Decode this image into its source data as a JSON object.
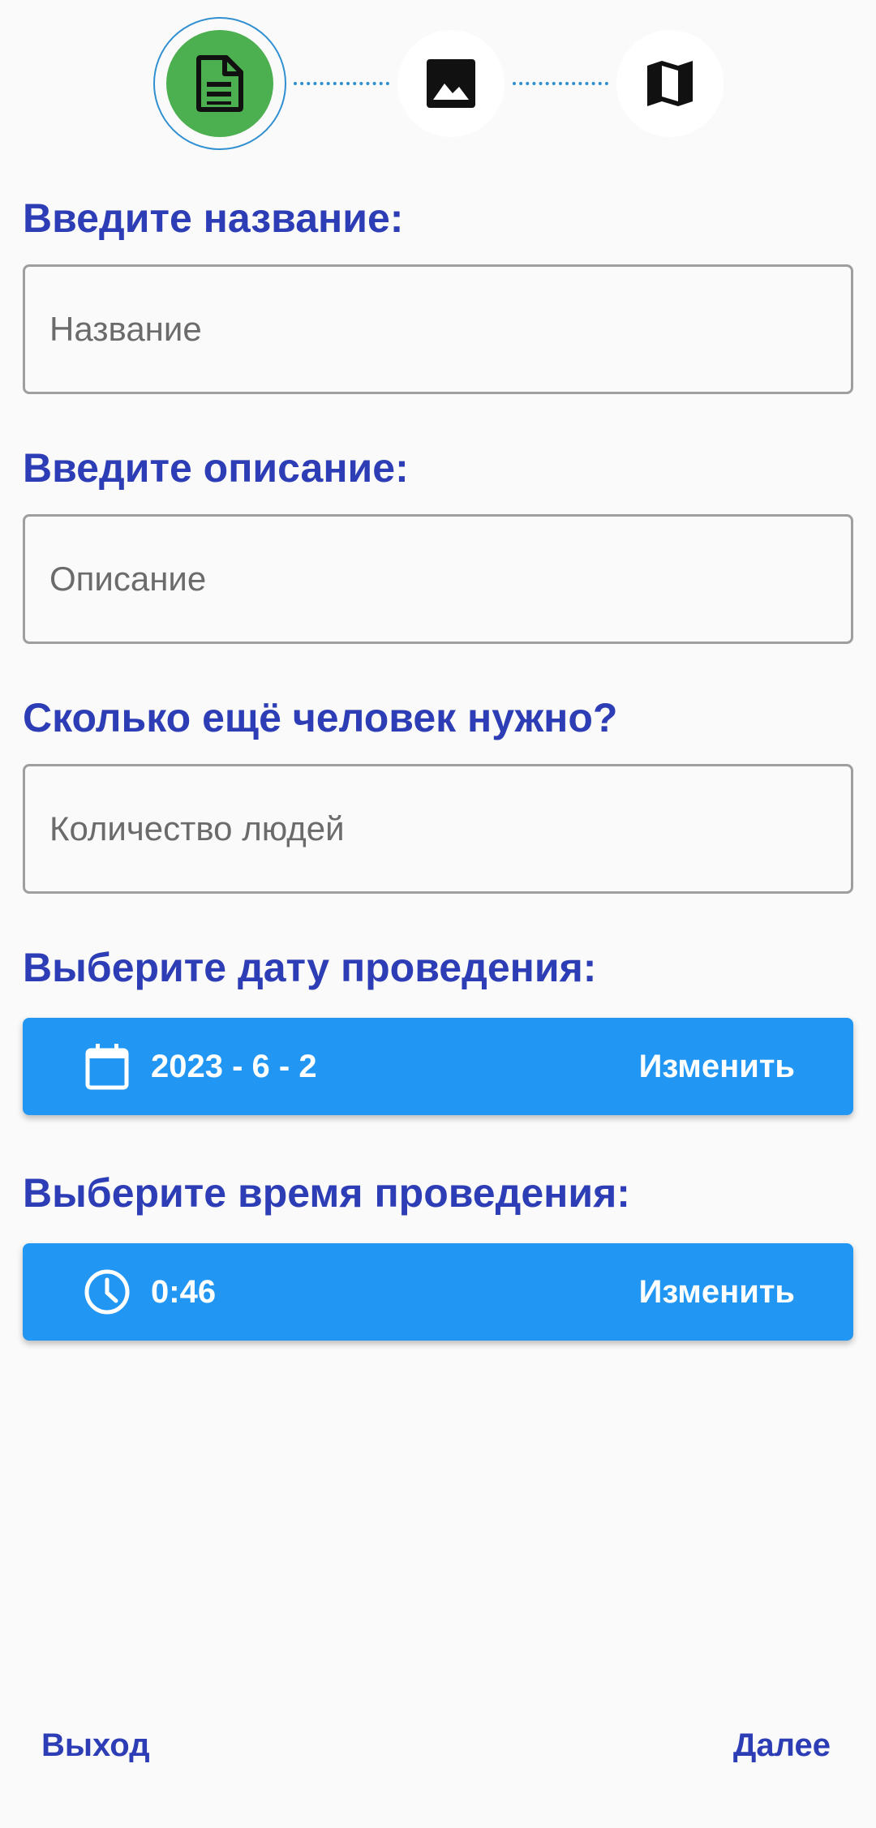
{
  "stepper": {
    "steps": [
      {
        "icon": "document-icon",
        "state": "active",
        "color": "#4caf50"
      },
      {
        "icon": "image-icon",
        "state": "pending"
      },
      {
        "icon": "map-icon",
        "state": "pending"
      }
    ],
    "connector_color": "#2f8fd0"
  },
  "form": {
    "name_label": "Введите название:",
    "name_placeholder": "Название",
    "name_value": "",
    "description_label": "Введите описание:",
    "description_placeholder": "Описание",
    "description_value": "",
    "people_label": "Сколько ещё человек нужно?",
    "people_placeholder": "Количество людей",
    "people_value": "",
    "date_label": "Выберите дату проведения:",
    "date_value": "2023 - 6 - 2",
    "date_action": "Изменить",
    "time_label": "Выберите время проведения:",
    "time_value": "0:46",
    "time_action": "Изменить"
  },
  "footer": {
    "exit_label": "Выход",
    "next_label": "Далее"
  },
  "colors": {
    "label": "#2d3db5",
    "picker_background": "#2196f3",
    "background": "#fafafa"
  }
}
